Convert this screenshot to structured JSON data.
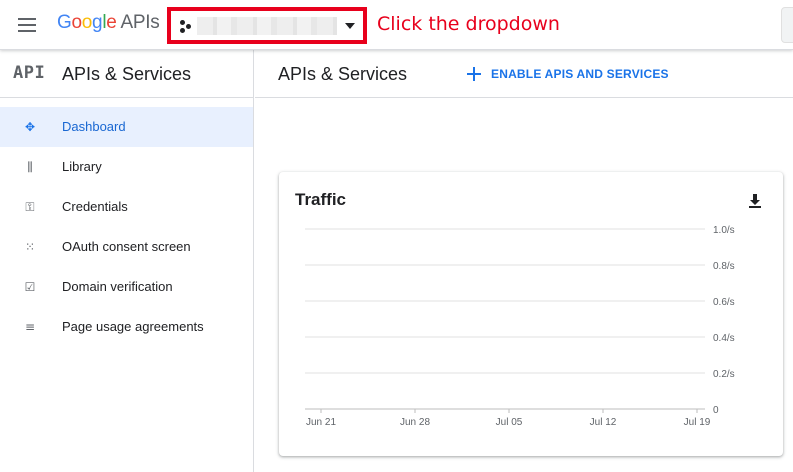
{
  "topbar": {
    "logo_brand": "Google",
    "logo_product": "APIs",
    "annotation": "Click the dropdown",
    "icons": {
      "menu": "hamburger-menu-icon",
      "project": "project-dots-icon",
      "dropdown": "caret-down-icon"
    }
  },
  "sidebar": {
    "icon_text": "API",
    "title": "APIs & Services",
    "items": [
      {
        "label": "Dashboard",
        "icon": "✥",
        "active": true
      },
      {
        "label": "Library",
        "icon": "⫼",
        "active": false
      },
      {
        "label": "Credentials",
        "icon": "⚿",
        "active": false
      },
      {
        "label": "OAuth consent screen",
        "icon": "⁙",
        "active": false
      },
      {
        "label": "Domain verification",
        "icon": "☑",
        "active": false
      },
      {
        "label": "Page usage agreements",
        "icon": "≡",
        "active": false
      }
    ]
  },
  "main": {
    "title": "APIs & Services",
    "enable_label": "ENABLE APIS AND SERVICES"
  },
  "card": {
    "title": "Traffic"
  },
  "colors": {
    "accent": "#1a73e8",
    "annotation": "#e8001c",
    "active_bg": "#e8f0fe"
  },
  "chart_data": {
    "type": "line",
    "title": "Traffic",
    "x": [
      "Jun 21",
      "Jun 28",
      "Jul 05",
      "Jul 12",
      "Jul 19"
    ],
    "y_ticks": [
      "1.0/s",
      "0.8/s",
      "0.6/s",
      "0.4/s",
      "0.2/s",
      "0"
    ],
    "ylim": [
      0,
      1.0
    ],
    "series": [],
    "grid": true
  }
}
